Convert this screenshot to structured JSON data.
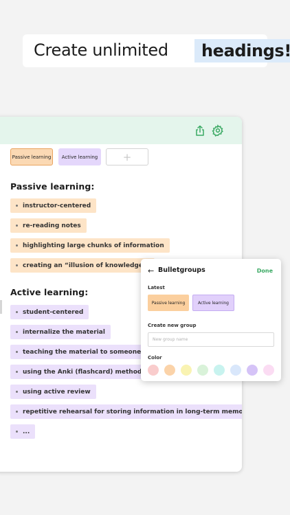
{
  "banner": {
    "text": "Create unlimited",
    "highlight": "headings!"
  },
  "header": {
    "share_icon": "share-icon",
    "settings_icon": "gear-icon",
    "accent": "#3aa963"
  },
  "chips": {
    "passive": "Passive learning",
    "active": "Active learning",
    "add": "+"
  },
  "sections": {
    "passive": {
      "title": "Passive learning:",
      "items": [
        "instructor-centered",
        "re-reading notes",
        "highlighting large chunks of information",
        "creating an “illusion of knowledge.”"
      ]
    },
    "active": {
      "title": "Active learning:",
      "items": [
        "student-centered",
        "internalize the material",
        "teaching the material to someone",
        "using the Anki (flashcard) method",
        "using active review",
        "repetitive rehearsal for storing information in long-term memory",
        "..."
      ]
    }
  },
  "popup": {
    "back": "←",
    "title": "Bulletgroups",
    "done": "Done",
    "latest_label": "Latest",
    "latest": [
      "Passive learning",
      "Active learning"
    ],
    "create_label": "Create new group",
    "input_placeholder": "New group name",
    "color_label": "Color",
    "colors": [
      "#f9cccc",
      "#fbd3a9",
      "#f9f3b2",
      "#d9f2d9",
      "#c8f3ef",
      "#d9e7fb",
      "#d5c3f7",
      "#fbdcf3"
    ]
  }
}
